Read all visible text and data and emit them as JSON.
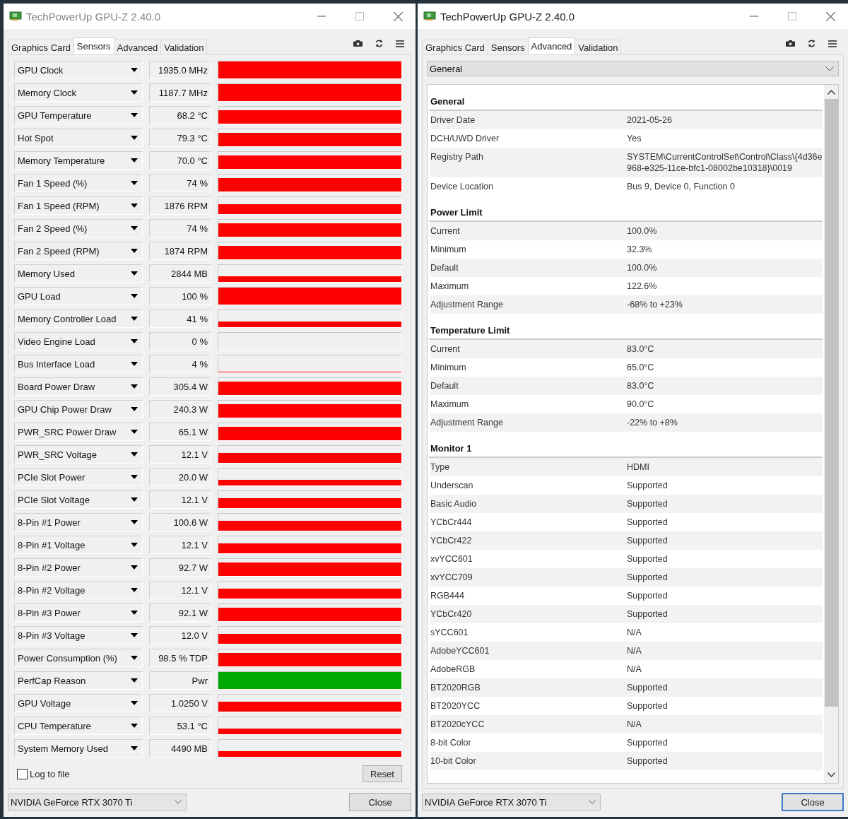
{
  "sensors_window": {
    "title": "TechPowerUp GPU-Z 2.40.0",
    "tabs": [
      {
        "label": "Graphics Card",
        "selected": false
      },
      {
        "label": "Sensors",
        "selected": true
      },
      {
        "label": "Advanced",
        "selected": false
      },
      {
        "label": "Validation",
        "selected": false
      }
    ],
    "sensors": [
      {
        "name": "GPU Clock",
        "value": "1935.0 MHz",
        "kind": "full",
        "color": "#ff0000"
      },
      {
        "name": "Memory Clock",
        "value": "1187.7 MHz",
        "kind": "full",
        "color": "#ff0000"
      },
      {
        "name": "GPU Temperature",
        "value": "68.2 °C",
        "kind": "high",
        "color": "#ff0000"
      },
      {
        "name": "Hot Spot",
        "value": "79.3 °C",
        "kind": "high",
        "color": "#ff0000"
      },
      {
        "name": "Memory Temperature",
        "value": "70.0 °C",
        "kind": "high",
        "color": "#ff0000"
      },
      {
        "name": "Fan 1 Speed (%)",
        "value": "74 %",
        "kind": "high",
        "color": "#ff0000"
      },
      {
        "name": "Fan 1 Speed (RPM)",
        "value": "1876 RPM",
        "kind": "mid",
        "color": "#ff0000"
      },
      {
        "name": "Fan 2 Speed (%)",
        "value": "74 %",
        "kind": "high",
        "color": "#ff0000"
      },
      {
        "name": "Fan 2 Speed (RPM)",
        "value": "1874 RPM",
        "kind": "high",
        "color": "#ff0000"
      },
      {
        "name": "Memory Used",
        "value": "2844 MB",
        "kind": "low",
        "color": "#ff0000"
      },
      {
        "name": "GPU Load",
        "value": "100 %",
        "kind": "full",
        "color": "#ff0000"
      },
      {
        "name": "Memory Controller Load",
        "value": "41 %",
        "kind": "low",
        "color": "#ff0000"
      },
      {
        "name": "Video Engine Load",
        "value": "0 %",
        "kind": "empty"
      },
      {
        "name": "Bus Interface Load",
        "value": "4 %",
        "kind": "flat",
        "color": "#ff0000"
      },
      {
        "name": "Board Power Draw",
        "value": "305.4 W",
        "kind": "high",
        "color": "#ff0000"
      },
      {
        "name": "GPU Chip Power Draw",
        "value": "240.3 W",
        "kind": "high",
        "color": "#ff0000"
      },
      {
        "name": "PWR_SRC Power Draw",
        "value": "65.1 W",
        "kind": "high",
        "color": "#ff0000"
      },
      {
        "name": "PWR_SRC Voltage",
        "value": "12.1 V",
        "kind": "mid",
        "color": "#ff0000"
      },
      {
        "name": "PCIe Slot Power",
        "value": "20.0 W",
        "kind": "low",
        "color": "#ff0000"
      },
      {
        "name": "PCIe Slot Voltage",
        "value": "12.1 V",
        "kind": "mid",
        "color": "#ff0000"
      },
      {
        "name": "8-Pin #1 Power",
        "value": "100.6 W",
        "kind": "mid",
        "color": "#ff0000"
      },
      {
        "name": "8-Pin #1 Voltage",
        "value": "12.1 V",
        "kind": "mid",
        "color": "#ff0000"
      },
      {
        "name": "8-Pin #2 Power",
        "value": "92.7 W",
        "kind": "high",
        "color": "#ff0000"
      },
      {
        "name": "8-Pin #2 Voltage",
        "value": "12.1 V",
        "kind": "mid",
        "color": "#ff0000"
      },
      {
        "name": "8-Pin #3 Power",
        "value": "92.1 W",
        "kind": "high",
        "color": "#ff0000"
      },
      {
        "name": "8-Pin #3 Voltage",
        "value": "12.0 V",
        "kind": "mid",
        "color": "#ff0000"
      },
      {
        "name": "Power Consumption (%)",
        "value": "98.5 % TDP",
        "kind": "high",
        "color": "#ff0000"
      },
      {
        "name": "PerfCap Reason",
        "value": "Pwr",
        "kind": "full",
        "color": "#00a800"
      },
      {
        "name": "GPU Voltage",
        "value": "1.0250 V",
        "kind": "mid",
        "color": "#ff0000"
      },
      {
        "name": "CPU Temperature",
        "value": "53.1 °C",
        "kind": "low",
        "color": "#ff0000"
      },
      {
        "name": "System Memory Used",
        "value": "4490 MB",
        "kind": "low",
        "color": "#ff0000"
      }
    ],
    "log_to_file": {
      "label": "Log to file",
      "checked": false
    },
    "reset_button": "Reset",
    "device_select": "NVIDIA GeForce RTX 3070 Ti",
    "close_button": {
      "label": "Close",
      "focused": false
    }
  },
  "advanced_window": {
    "title": "TechPowerUp GPU-Z 2.40.0",
    "tabs": [
      {
        "label": "Graphics Card",
        "selected": false
      },
      {
        "label": "Sensors",
        "selected": false
      },
      {
        "label": "Advanced",
        "selected": true
      },
      {
        "label": "Validation",
        "selected": false
      }
    ],
    "category_select": "General",
    "sections": [
      {
        "title": "General",
        "rows": [
          {
            "key": "Driver Date",
            "value": "2021-05-26"
          },
          {
            "key": "DCH/UWD Driver",
            "value": "Yes"
          },
          {
            "key": "Registry Path",
            "value": "SYSTEM\\CurrentControlSet\\Control\\Class\\{4d36e968-e325-11ce-bfc1-08002be10318}\\0019"
          },
          {
            "key": "Device Location",
            "value": "Bus 9, Device 0, Function 0"
          }
        ]
      },
      {
        "title": "Power Limit",
        "rows": [
          {
            "key": "Current",
            "value": "100.0%"
          },
          {
            "key": "Minimum",
            "value": "32.3%"
          },
          {
            "key": "Default",
            "value": "100.0%"
          },
          {
            "key": "Maximum",
            "value": "122.6%"
          },
          {
            "key": "Adjustment Range",
            "value": "-68% to +23%"
          }
        ]
      },
      {
        "title": "Temperature Limit",
        "rows": [
          {
            "key": "Current",
            "value": "83.0°C"
          },
          {
            "key": "Minimum",
            "value": "65.0°C"
          },
          {
            "key": "Default",
            "value": "83.0°C"
          },
          {
            "key": "Maximum",
            "value": "90.0°C"
          },
          {
            "key": "Adjustment Range",
            "value": "-22% to +8%"
          }
        ]
      },
      {
        "title": "Monitor 1",
        "rows": [
          {
            "key": "Type",
            "value": "HDMI"
          },
          {
            "key": "Underscan",
            "value": "Supported"
          },
          {
            "key": "Basic Audio",
            "value": "Supported"
          },
          {
            "key": "YCbCr444",
            "value": "Supported"
          },
          {
            "key": "YCbCr422",
            "value": "Supported"
          },
          {
            "key": "xvYCC601",
            "value": "Supported"
          },
          {
            "key": "xvYCC709",
            "value": "Supported"
          },
          {
            "key": "RGB444",
            "value": "Supported"
          },
          {
            "key": "YCbCr420",
            "value": "Supported"
          },
          {
            "key": "sYCC601",
            "value": "N/A"
          },
          {
            "key": "AdobeYCC601",
            "value": "N/A"
          },
          {
            "key": "AdobeRGB",
            "value": "N/A"
          },
          {
            "key": "BT2020RGB",
            "value": "Supported"
          },
          {
            "key": "BT2020YCC",
            "value": "Supported"
          },
          {
            "key": "BT2020cYCC",
            "value": "N/A"
          },
          {
            "key": "8-bit Color",
            "value": "Supported"
          },
          {
            "key": "10-bit Color",
            "value": "Supported"
          }
        ]
      }
    ],
    "device_select": "NVIDIA GeForce RTX 3070 Ti",
    "close_button": {
      "label": "Close",
      "focused": true
    }
  }
}
